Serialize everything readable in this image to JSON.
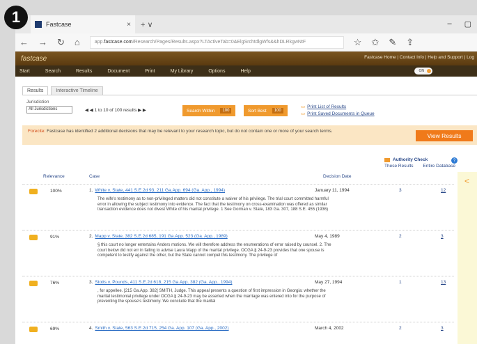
{
  "step_number": "1",
  "browser": {
    "tab_title": "Fastcase",
    "tab_close": "×",
    "new_tab": "+ ∨",
    "window_controls": [
      "–",
      "▢"
    ],
    "url_prefix": "app.",
    "url_domain": "fastcase.com",
    "url_rest": "/Research/Pages/Results.aspx?LTActiveTab=0&ElgSrchtdlgWfs&&hDLRkgwNtF",
    "nav_icons": [
      "←",
      "→",
      "↻",
      "⌂"
    ],
    "toolbar_icons": [
      "☆",
      "✩",
      "✎",
      "⇪"
    ]
  },
  "fastcase": {
    "logo": "fastcase",
    "top_links": "Fastcase Home | Contact Info | Help and Support | Log",
    "nav": [
      "Start",
      "Search",
      "Results",
      "Document",
      "Print",
      "My Library",
      "Options",
      "Help"
    ],
    "toggle_label": "ON"
  },
  "results_tabs": [
    "Results",
    "Interactive Timeline"
  ],
  "toolbar": {
    "jurisdiction_label": "Jurisdiction",
    "jurisdiction_value": "All Jurisdictions",
    "pager": "◀ ◀ 1 to 10 of 100 results ▶ ▶",
    "search_within_label": "Search Within",
    "search_within_count": "100",
    "sort_by_label": "Sort Best",
    "sort_by_count": "100",
    "print_list": "Print List of Results",
    "print_saved": "Print Saved Documents in Queue"
  },
  "notice": {
    "prefix": "Forecite:",
    "text": "Fastcase has identified 2 additional decisions that may be relevant to your research topic, but do not contain one or more of your search terms.",
    "button": "View Results"
  },
  "authority_check": {
    "title": "Authority Check",
    "col1": "These Results",
    "col2": "Entire Database"
  },
  "table_headers": {
    "relevance": "Relevance",
    "case": "Case",
    "decision_date": "Decision Date"
  },
  "results": [
    {
      "num": "1.",
      "relevance": "100%",
      "title": "White v. State, 441 S.E.2d 93, 211 Ga.App. 694 (Ga. App., 1994)",
      "date": "January 11, 1994",
      "snippet": "The wife's testimony as to non-privileged matters did not constitute a waiver of his privilege. The trial court committed harmful error in allowing the subject testimony into evidence. The fact that the testimony on cross-examination was offered as similar transaction evidence does not divest White of his marital privilege. 1 See Gorman v. State, 183 Ga. 307, 188 S.E. 455 (1936)",
      "these": "3",
      "entire": "12"
    },
    {
      "num": "2.",
      "relevance": "91%",
      "title": "Mapp v. State, 382 S.E.2d 685, 191 Ga.App. 523 (Ga. App., 1989)",
      "date": "May 4, 1989",
      "snippet": "§ this court no longer entertains Anders motions. We will therefore address the enumerations of error raised by counsel. 2. The court below did not err in failing to advise Laura Mapp of the marital privilege. OCGA § 24-9-23 provides that one spouse is competent to testify against the other, but the State cannot compel this testimony. The privilege of",
      "these": "2",
      "entire": "3"
    },
    {
      "num": "3.",
      "relevance": "76%",
      "title": "Stotts v. Pounds, 411 S.E.2d 618, 215 Ga.App. 382 (Ga. App., 1994)",
      "date": "May 27, 1994",
      "snippet": ", for appellee. [215 Ga.App. 382] SMITH, Judge. This appeal presents a question of first impression in Georgia: whether the marital testimonial privilege under OCGA § 24-9-23 may be asserted when the marriage was entered into for the purpose of preventing the spouse's testimony. We conclude that the marital",
      "these": "1",
      "entire": "13"
    },
    {
      "num": "4.",
      "relevance": "69%",
      "title": "Smith v. State, 563 S.E.2d 715, 254 Ga. App. 107 (Ga. App., 2002)",
      "date": "March 4, 2002",
      "snippet": "",
      "these": "2",
      "entire": "3"
    }
  ],
  "colors": {
    "header_brown": "#7a5520",
    "nav_dark": "#3d2f18",
    "orange": "#f09a2e",
    "notice_bg": "#fbe6c4",
    "link_blue": "#2b6dc4"
  }
}
